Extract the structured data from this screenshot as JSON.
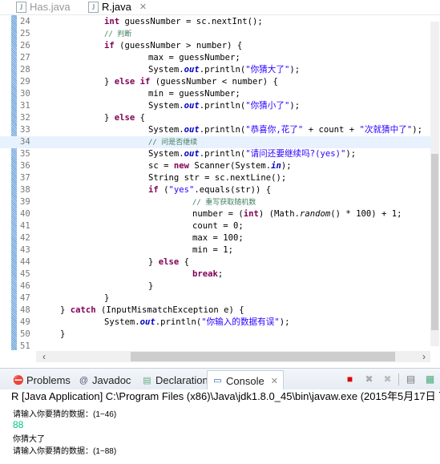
{
  "editor_tabs": [
    {
      "label": "Has.java",
      "active": false
    },
    {
      "label": "R.java",
      "active": true
    }
  ],
  "code_lines": [
    {
      "num": "24",
      "indent": 2,
      "t": [
        [
          "k",
          "int"
        ],
        [
          "n",
          " guessNumber = sc.nextInt();"
        ]
      ]
    },
    {
      "num": "25",
      "indent": 2,
      "t": [
        [
          "c",
          "// 判断"
        ]
      ]
    },
    {
      "num": "26",
      "indent": 2,
      "t": [
        [
          "k",
          "if"
        ],
        [
          "n",
          " (guessNumber > number) {"
        ]
      ]
    },
    {
      "num": "27",
      "indent": 3,
      "t": [
        [
          "n",
          "max = guessNumber;"
        ]
      ]
    },
    {
      "num": "28",
      "indent": 3,
      "t": [
        [
          "n",
          "System."
        ],
        [
          "f",
          "out"
        ],
        [
          "n",
          ".println("
        ],
        [
          "s",
          "\"你猜大了\""
        ],
        [
          "n",
          ");"
        ]
      ]
    },
    {
      "num": "29",
      "indent": 2,
      "t": [
        [
          "n",
          "} "
        ],
        [
          "k",
          "else if"
        ],
        [
          "n",
          " (guessNumber < number) {"
        ]
      ]
    },
    {
      "num": "30",
      "indent": 3,
      "t": [
        [
          "n",
          "min = guessNumber;"
        ]
      ]
    },
    {
      "num": "31",
      "indent": 3,
      "t": [
        [
          "n",
          "System."
        ],
        [
          "f",
          "out"
        ],
        [
          "n",
          ".println("
        ],
        [
          "s",
          "\"你猜小了\""
        ],
        [
          "n",
          ");"
        ]
      ]
    },
    {
      "num": "32",
      "indent": 2,
      "t": [
        [
          "n",
          "} "
        ],
        [
          "k",
          "else"
        ],
        [
          "n",
          " {"
        ]
      ]
    },
    {
      "num": "33",
      "indent": 3,
      "t": [
        [
          "n",
          "System."
        ],
        [
          "f",
          "out"
        ],
        [
          "n",
          ".println("
        ],
        [
          "s",
          "\"恭喜你,花了\""
        ],
        [
          "n",
          " + count + "
        ],
        [
          "s",
          "\"次就猜中了\""
        ],
        [
          "n",
          ");"
        ]
      ]
    },
    {
      "num": "34",
      "indent": 3,
      "hl": true,
      "t": [
        [
          "c",
          "// 问是否继续"
        ]
      ]
    },
    {
      "num": "35",
      "indent": 3,
      "t": [
        [
          "n",
          "System."
        ],
        [
          "f",
          "out"
        ],
        [
          "n",
          ".println("
        ],
        [
          "s",
          "\"请问还要继续吗?(yes)\""
        ],
        [
          "n",
          ");"
        ]
      ]
    },
    {
      "num": "36",
      "indent": 3,
      "t": [
        [
          "n",
          "sc = "
        ],
        [
          "k",
          "new"
        ],
        [
          "n",
          " Scanner(System."
        ],
        [
          "f",
          "in"
        ],
        [
          "n",
          ");"
        ]
      ]
    },
    {
      "num": "37",
      "indent": 3,
      "t": [
        [
          "n",
          "String str = sc.nextLine();"
        ]
      ]
    },
    {
      "num": "38",
      "indent": 3,
      "t": [
        [
          "k",
          "if"
        ],
        [
          "n",
          " ("
        ],
        [
          "s",
          "\"yes\""
        ],
        [
          "n",
          ".equals(str)) {"
        ]
      ]
    },
    {
      "num": "39",
      "indent": 4,
      "t": [
        [
          "c",
          "// 重写获取随机数"
        ]
      ]
    },
    {
      "num": "40",
      "indent": 4,
      "t": [
        [
          "n",
          "number = ("
        ],
        [
          "k",
          "int"
        ],
        [
          "n",
          ") (Math."
        ],
        [
          "m",
          "random"
        ],
        [
          "n",
          "() * 100) + 1;"
        ]
      ]
    },
    {
      "num": "41",
      "indent": 4,
      "t": [
        [
          "n",
          "count = 0;"
        ]
      ]
    },
    {
      "num": "42",
      "indent": 4,
      "t": [
        [
          "n",
          "max = 100;"
        ]
      ]
    },
    {
      "num": "43",
      "indent": 4,
      "t": [
        [
          "n",
          "min = 1;"
        ]
      ]
    },
    {
      "num": "44",
      "indent": 3,
      "t": [
        [
          "n",
          "} "
        ],
        [
          "k",
          "else"
        ],
        [
          "n",
          " {"
        ]
      ]
    },
    {
      "num": "45",
      "indent": 4,
      "t": [
        [
          "k",
          "break"
        ],
        [
          "n",
          ";"
        ]
      ]
    },
    {
      "num": "46",
      "indent": 3,
      "t": [
        [
          "n",
          "}"
        ]
      ]
    },
    {
      "num": "47",
      "indent": 2,
      "t": [
        [
          "n",
          "}"
        ]
      ]
    },
    {
      "num": "48",
      "indent": 1,
      "t": [
        [
          "n",
          "} "
        ],
        [
          "k",
          "catch"
        ],
        [
          "n",
          " (InputMismatchException e) {"
        ]
      ]
    },
    {
      "num": "49",
      "indent": 2,
      "t": [
        [
          "n",
          "System."
        ],
        [
          "f",
          "out"
        ],
        [
          "n",
          ".println("
        ],
        [
          "s",
          "\"你输入的数据有误\""
        ],
        [
          "n",
          ");"
        ]
      ]
    },
    {
      "num": "50",
      "indent": 1,
      "t": [
        [
          "n",
          "}"
        ]
      ]
    },
    {
      "num": "51",
      "indent": 0,
      "t": []
    }
  ],
  "panel_tabs": [
    {
      "label": "Problems",
      "icon": "problems-icon"
    },
    {
      "label": "Javadoc",
      "icon": "at-icon"
    },
    {
      "label": "Declaration",
      "icon": "declaration-icon"
    },
    {
      "label": "Console",
      "icon": "console-icon",
      "active": true
    }
  ],
  "console": {
    "header": "R [Java Application] C:\\Program Files (x86)\\Java\\jdk1.8.0_45\\bin\\javaw.exe (2015年5月17日 下",
    "output": [
      {
        "text": "请输入你要猜的数据：(1~46)",
        "color": "#000000"
      },
      {
        "text": "88",
        "color": "#00c87d"
      },
      {
        "text": "你猜大了",
        "color": "#000000"
      },
      {
        "text": "请输入你要猜的数据：(1~88)",
        "color": "#000000"
      }
    ]
  }
}
